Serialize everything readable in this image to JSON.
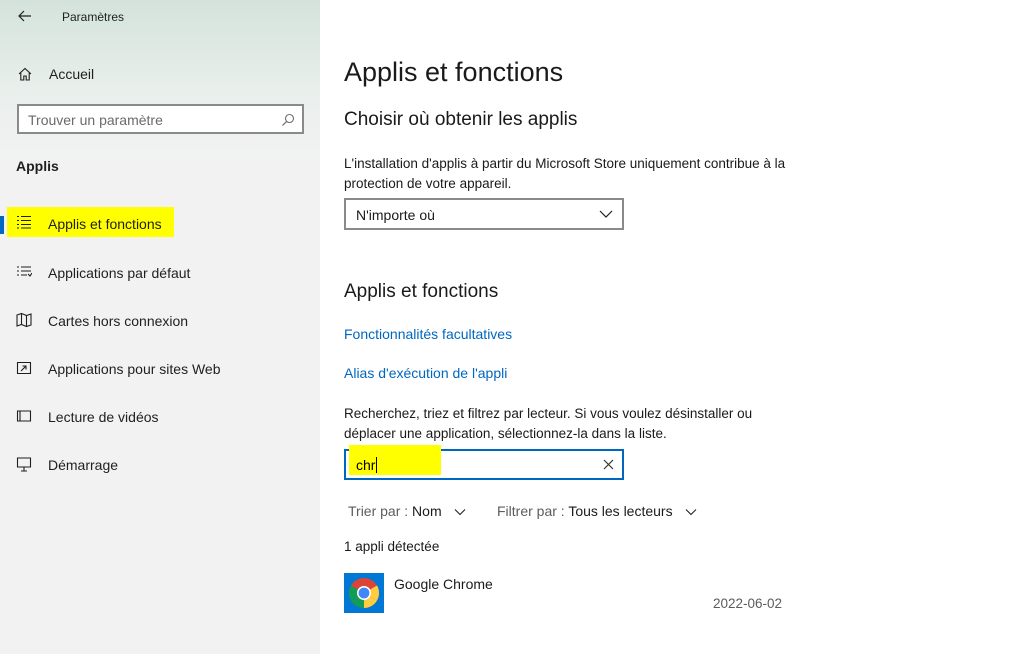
{
  "window": {
    "title": "Paramètres"
  },
  "sidebar": {
    "home_label": "Accueil",
    "search_placeholder": "Trouver un paramètre",
    "section_heading": "Applis",
    "items": [
      {
        "label": "Applis et fonctions",
        "icon": "apps-features-icon",
        "active": true
      },
      {
        "label": "Applications par défaut",
        "icon": "default-apps-icon"
      },
      {
        "label": "Cartes hors connexion",
        "icon": "offline-maps-icon"
      },
      {
        "label": "Applications pour sites Web",
        "icon": "apps-for-websites-icon"
      },
      {
        "label": "Lecture de vidéos",
        "icon": "video-playback-icon"
      },
      {
        "label": "Démarrage",
        "icon": "startup-icon"
      }
    ]
  },
  "main": {
    "title": "Applis et fonctions",
    "choose_heading": "Choisir où obtenir les applis",
    "choose_description": "L'installation d'applis à partir du Microsoft Store uniquement contribue à la protection de votre appareil.",
    "source_dropdown_value": "N'importe où",
    "features_heading": "Applis et fonctions",
    "optional_features_link": "Fonctionnalités facultatives",
    "app_alias_link": "Alias d'exécution de l'appli",
    "search_description": "Recherchez, triez et filtrez par lecteur. Si vous voulez désinstaller ou déplacer une application, sélectionnez-la dans la liste.",
    "search_value": "chr",
    "sort_label": "Trier par :",
    "sort_value": "Nom",
    "filter_label": "Filtrer par :",
    "filter_value": "Tous les lecteurs",
    "result_count": "1 appli détectée",
    "apps": [
      {
        "name": "Google Chrome",
        "date": "2022-06-02",
        "icon": "google-chrome-icon"
      }
    ]
  },
  "colors": {
    "accent": "#0067c0",
    "highlight": "#ffff00",
    "sidebar_bg": "#f2f2f2"
  }
}
